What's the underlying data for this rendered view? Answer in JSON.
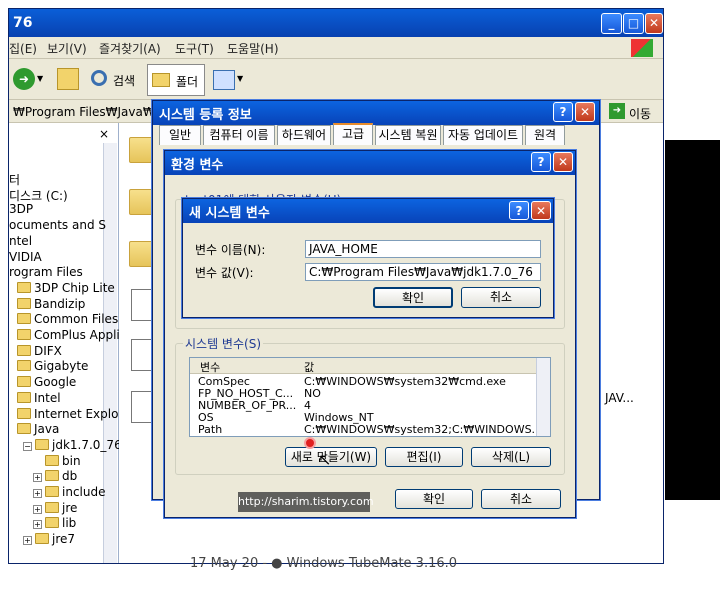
{
  "explorer": {
    "title": "76",
    "menu": [
      "집(E)",
      "보기(V)",
      "즐겨찾기(A)",
      "도구(T)",
      "도움말(H)"
    ],
    "toolbar": {
      "search_label": "검색",
      "folders_label": "폴더"
    },
    "address": "₩Program Files₩Java₩jdk",
    "go_label": "이동",
    "tree": [
      {
        "label": "터",
        "indent": 0
      },
      {
        "label": "디스크 (C:)",
        "indent": 0
      },
      {
        "label": "3DP",
        "indent": 0
      },
      {
        "label": "ocuments and S",
        "indent": 0
      },
      {
        "label": "ntel",
        "indent": 0
      },
      {
        "label": "VIDIA",
        "indent": 0
      },
      {
        "label": "rogram Files",
        "indent": 0
      },
      {
        "label": "3DP Chip Lite",
        "indent": 1
      },
      {
        "label": "Bandizip",
        "indent": 1
      },
      {
        "label": "Common Files",
        "indent": 1
      },
      {
        "label": "ComPlus Appli",
        "indent": 1
      },
      {
        "label": "DIFX",
        "indent": 1
      },
      {
        "label": "Gigabyte",
        "indent": 1
      },
      {
        "label": "Google",
        "indent": 1
      },
      {
        "label": "Intel",
        "indent": 1
      },
      {
        "label": "Internet Explor",
        "indent": 1
      },
      {
        "label": "Java",
        "indent": 1
      },
      {
        "label": "jdk1.7.0_76",
        "indent": 2
      },
      {
        "label": "bin",
        "indent": 3
      },
      {
        "label": "db",
        "indent": 3
      },
      {
        "label": "include",
        "indent": 3
      },
      {
        "label": "jre",
        "indent": 3
      },
      {
        "label": "lib",
        "indent": 3
      },
      {
        "label": "jre7",
        "indent": 2
      }
    ],
    "content_side_text": "JAV...",
    "bottom_text": "17 May 20 - ● Windows TubeMate 3.16.0"
  },
  "sysprops": {
    "title": "시스템 등록 정보",
    "tabs": [
      "일반",
      "컴퓨터 이름",
      "하드웨어",
      "고급",
      "시스템 복원",
      "자동 업데이트",
      "원격"
    ]
  },
  "envvars": {
    "title": "환경 변수",
    "user_group_label": "test01에 대한 사용자 변수(U)",
    "system_group_label": "시스템 변수(S)",
    "columns": [
      "변수",
      "값"
    ],
    "rows": [
      {
        "name": "ComSpec",
        "value": "C:₩WINDOWS₩system32₩cmd.exe"
      },
      {
        "name": "FP_NO_HOST_C...",
        "value": "NO"
      },
      {
        "name": "NUMBER_OF_PR...",
        "value": "4"
      },
      {
        "name": "OS",
        "value": "Windows_NT"
      },
      {
        "name": "Path",
        "value": "C:₩WINDOWS₩system32;C:₩WINDOWS..."
      }
    ],
    "new_button": "새로 만들기(W)",
    "edit_button": "편집(I)",
    "delete_button": "삭제(L)",
    "ok_button": "확인",
    "cancel_button": "취소"
  },
  "newvar": {
    "title": "새 시스템 변수",
    "name_label": "변수 이름(N):",
    "name_value": "JAVA_HOME",
    "value_label": "변수 값(V):",
    "value_value": "C:₩Program Files₩Java₩jdk1.7.0_76",
    "ok_button": "확인",
    "cancel_button": "취소"
  },
  "watermark": "http://sharim.tistory.com",
  "colors": {
    "title_bar": "#0a5fd8",
    "dialog_bg": "#ece9d8",
    "accent_link": "#1f3a93",
    "cursor_marker": "#e02020"
  }
}
